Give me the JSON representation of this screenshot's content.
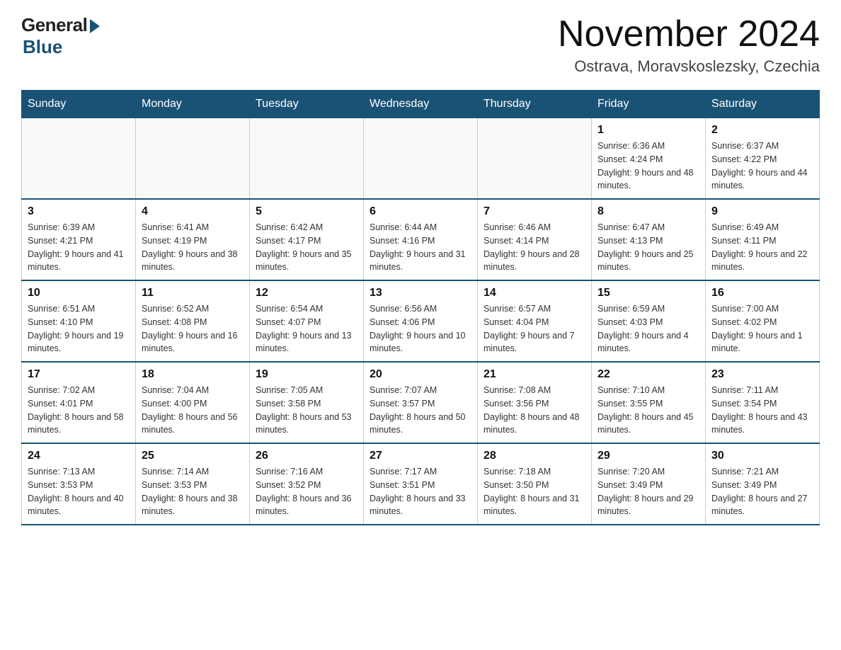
{
  "logo": {
    "general": "General",
    "blue": "Blue"
  },
  "title": "November 2024",
  "location": "Ostrava, Moravskoslezsky, Czechia",
  "days": [
    "Sunday",
    "Monday",
    "Tuesday",
    "Wednesday",
    "Thursday",
    "Friday",
    "Saturday"
  ],
  "weeks": [
    [
      {
        "day": "",
        "info": ""
      },
      {
        "day": "",
        "info": ""
      },
      {
        "day": "",
        "info": ""
      },
      {
        "day": "",
        "info": ""
      },
      {
        "day": "",
        "info": ""
      },
      {
        "day": "1",
        "info": "Sunrise: 6:36 AM\nSunset: 4:24 PM\nDaylight: 9 hours and 48 minutes."
      },
      {
        "day": "2",
        "info": "Sunrise: 6:37 AM\nSunset: 4:22 PM\nDaylight: 9 hours and 44 minutes."
      }
    ],
    [
      {
        "day": "3",
        "info": "Sunrise: 6:39 AM\nSunset: 4:21 PM\nDaylight: 9 hours and 41 minutes."
      },
      {
        "day": "4",
        "info": "Sunrise: 6:41 AM\nSunset: 4:19 PM\nDaylight: 9 hours and 38 minutes."
      },
      {
        "day": "5",
        "info": "Sunrise: 6:42 AM\nSunset: 4:17 PM\nDaylight: 9 hours and 35 minutes."
      },
      {
        "day": "6",
        "info": "Sunrise: 6:44 AM\nSunset: 4:16 PM\nDaylight: 9 hours and 31 minutes."
      },
      {
        "day": "7",
        "info": "Sunrise: 6:46 AM\nSunset: 4:14 PM\nDaylight: 9 hours and 28 minutes."
      },
      {
        "day": "8",
        "info": "Sunrise: 6:47 AM\nSunset: 4:13 PM\nDaylight: 9 hours and 25 minutes."
      },
      {
        "day": "9",
        "info": "Sunrise: 6:49 AM\nSunset: 4:11 PM\nDaylight: 9 hours and 22 minutes."
      }
    ],
    [
      {
        "day": "10",
        "info": "Sunrise: 6:51 AM\nSunset: 4:10 PM\nDaylight: 9 hours and 19 minutes."
      },
      {
        "day": "11",
        "info": "Sunrise: 6:52 AM\nSunset: 4:08 PM\nDaylight: 9 hours and 16 minutes."
      },
      {
        "day": "12",
        "info": "Sunrise: 6:54 AM\nSunset: 4:07 PM\nDaylight: 9 hours and 13 minutes."
      },
      {
        "day": "13",
        "info": "Sunrise: 6:56 AM\nSunset: 4:06 PM\nDaylight: 9 hours and 10 minutes."
      },
      {
        "day": "14",
        "info": "Sunrise: 6:57 AM\nSunset: 4:04 PM\nDaylight: 9 hours and 7 minutes."
      },
      {
        "day": "15",
        "info": "Sunrise: 6:59 AM\nSunset: 4:03 PM\nDaylight: 9 hours and 4 minutes."
      },
      {
        "day": "16",
        "info": "Sunrise: 7:00 AM\nSunset: 4:02 PM\nDaylight: 9 hours and 1 minute."
      }
    ],
    [
      {
        "day": "17",
        "info": "Sunrise: 7:02 AM\nSunset: 4:01 PM\nDaylight: 8 hours and 58 minutes."
      },
      {
        "day": "18",
        "info": "Sunrise: 7:04 AM\nSunset: 4:00 PM\nDaylight: 8 hours and 56 minutes."
      },
      {
        "day": "19",
        "info": "Sunrise: 7:05 AM\nSunset: 3:58 PM\nDaylight: 8 hours and 53 minutes."
      },
      {
        "day": "20",
        "info": "Sunrise: 7:07 AM\nSunset: 3:57 PM\nDaylight: 8 hours and 50 minutes."
      },
      {
        "day": "21",
        "info": "Sunrise: 7:08 AM\nSunset: 3:56 PM\nDaylight: 8 hours and 48 minutes."
      },
      {
        "day": "22",
        "info": "Sunrise: 7:10 AM\nSunset: 3:55 PM\nDaylight: 8 hours and 45 minutes."
      },
      {
        "day": "23",
        "info": "Sunrise: 7:11 AM\nSunset: 3:54 PM\nDaylight: 8 hours and 43 minutes."
      }
    ],
    [
      {
        "day": "24",
        "info": "Sunrise: 7:13 AM\nSunset: 3:53 PM\nDaylight: 8 hours and 40 minutes."
      },
      {
        "day": "25",
        "info": "Sunrise: 7:14 AM\nSunset: 3:53 PM\nDaylight: 8 hours and 38 minutes."
      },
      {
        "day": "26",
        "info": "Sunrise: 7:16 AM\nSunset: 3:52 PM\nDaylight: 8 hours and 36 minutes."
      },
      {
        "day": "27",
        "info": "Sunrise: 7:17 AM\nSunset: 3:51 PM\nDaylight: 8 hours and 33 minutes."
      },
      {
        "day": "28",
        "info": "Sunrise: 7:18 AM\nSunset: 3:50 PM\nDaylight: 8 hours and 31 minutes."
      },
      {
        "day": "29",
        "info": "Sunrise: 7:20 AM\nSunset: 3:49 PM\nDaylight: 8 hours and 29 minutes."
      },
      {
        "day": "30",
        "info": "Sunrise: 7:21 AM\nSunset: 3:49 PM\nDaylight: 8 hours and 27 minutes."
      }
    ]
  ]
}
